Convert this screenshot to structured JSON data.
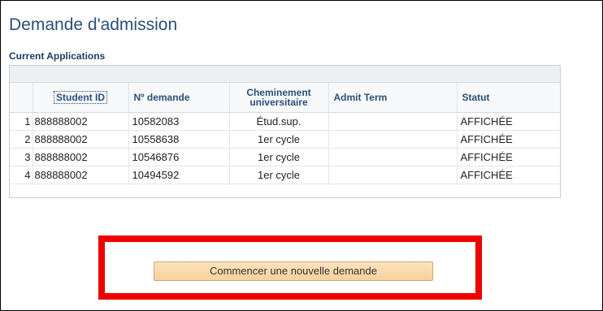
{
  "page": {
    "title": "Demande d'admission",
    "section_title": "Current Applications"
  },
  "table": {
    "headers": {
      "row_num": "",
      "student_id": "Student ID",
      "demande": "Nº demande",
      "cheminement": "Cheminement universitaire",
      "admit_term": "Admit Term",
      "statut": "Statut"
    },
    "rows": [
      {
        "num": "1",
        "student_id": "888888002",
        "demande": "10582083",
        "cheminement": "Étud.sup.",
        "admit_term": "",
        "statut": "AFFICHÉE"
      },
      {
        "num": "2",
        "student_id": "888888002",
        "demande": "10558638",
        "cheminement": "1er cycle",
        "admit_term": "",
        "statut": "AFFICHÉE"
      },
      {
        "num": "3",
        "student_id": "888888002",
        "demande": "10546876",
        "cheminement": "1er cycle",
        "admit_term": "",
        "statut": "AFFICHÉE"
      },
      {
        "num": "4",
        "student_id": "888888002",
        "demande": "10494592",
        "cheminement": "1er cycle",
        "admit_term": "",
        "statut": "AFFICHÉE"
      }
    ]
  },
  "actions": {
    "new_application_label": "Commencer une nouvelle demande"
  },
  "colors": {
    "title": "#2b4f7a",
    "highlight": "#ee0000",
    "button_bg": "#f6d29c"
  }
}
